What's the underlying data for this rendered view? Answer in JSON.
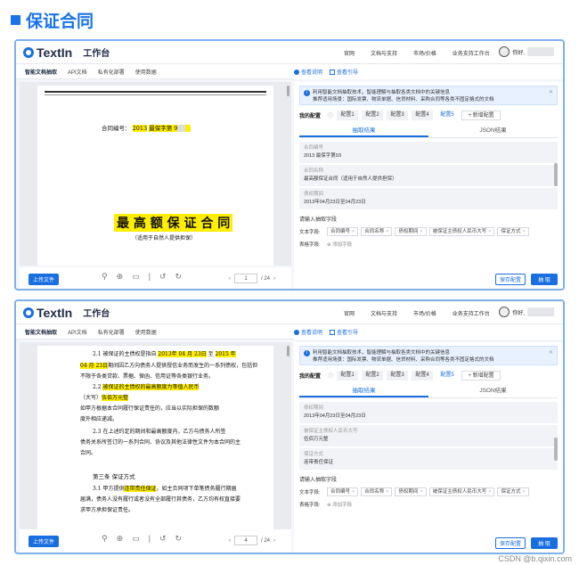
{
  "page": {
    "title": "保证合同"
  },
  "app": {
    "logo": "TextIn",
    "workspace": "工作台",
    "nav": [
      "官网",
      "文档与支持",
      "市场/价格",
      "业务支持工作台"
    ],
    "user": "你好,",
    "subnav": [
      "智能文档抽取",
      "API文档",
      "私有化部署",
      "使用数据"
    ],
    "links": [
      "查看说明",
      "查看引导"
    ]
  },
  "info": {
    "line1": "利用智能文档抽取技术，智能理解与抽取各类文档中的关键信息",
    "line2": "推荐适用场景：国际发票、物流单据、信贷材料、采购合同等各类不固定格式的文档"
  },
  "configs": {
    "label": "我的配置",
    "items": [
      "配置1",
      "配置2",
      "配置3",
      "配置4",
      "配置5"
    ],
    "active": "配置5",
    "new": "新增配置"
  },
  "tabs": [
    "抽取结果",
    "JSON结果"
  ],
  "extract": {
    "title": "请输入抽取字段",
    "text_label": "文本字段:",
    "table_label": "表格字段:",
    "add": "添加字段",
    "chips": [
      "合同编号",
      "合同名称",
      "债权期间",
      "被保证主债权人民币大写",
      "保证方式"
    ]
  },
  "buttons": {
    "upload": "上传文件",
    "save": "保存配置",
    "extract": "抽 取"
  },
  "panel1": {
    "page": "1",
    "total": "/ 24",
    "doc": {
      "contract_no_label": "合同编号：",
      "contract_year": "2013",
      "contract_mid": "最保字第 9",
      "title": "最 高 额 保 证 合 同",
      "subtitle": "（适用于自然人提供担保）"
    },
    "fields": [
      {
        "k": "合同编号",
        "v": "2013      最保字第93"
      },
      {
        "k": "合同名称",
        "v": "最高额保证合同（适用于自然人提供担保）"
      },
      {
        "k": "债权期间",
        "v": "2013年04月23日至04月23日"
      }
    ]
  },
  "panel2": {
    "page": "4",
    "total": "/ 24",
    "doc": {
      "l1a": "2.1  被保证的主债权是指自",
      "l1b": "2013年 04 月 23日",
      "l1c": "至",
      "l1d": "2015 年",
      "l2a": "04 月 23日",
      "l2b": "期间因乙方向债务人提供授信业务而发生的一系列债权，包括但",
      "l3": "不限于各类贷款、票据、保函、信用证等各类银行业务。",
      "l4a": "2.2",
      "l4b": "被保证的主债权的最高额度为等值人民币",
      "l5a": "（大写）",
      "l5b": "伍佰万元整",
      "l6": "如甲方根据本合同履行保证责任的，应当以实际担保的数额",
      "l7": "度外相应递减。",
      "l8": "2.3  在上述约定的期间和最高额度内，乙方与债务人所签",
      "l9": "债务关系所签订的一系列合同、协议及其他法律性文件为本合同的主",
      "l10": "合同。",
      "l11": "第三条  保证方式",
      "l12a": "3.1  甲方提供",
      "l12b": "连带责任保证",
      "l12c": "。如主合同项下单笔债务履行期届",
      "l13": "届满，债务人没有履行或者没有全部履行其债务，乙方均有权直接要",
      "l14": "求甲方承担保证责任。"
    },
    "fields": [
      {
        "k": "债权期间",
        "v": "2013年04月23日至04月23日"
      },
      {
        "k": "被保证主债权人民币大写",
        "v": "伍佰万元整"
      },
      {
        "k": "保证方式",
        "v": "连带责任保证"
      }
    ]
  },
  "credit": "CSDN @b.qixin.com"
}
